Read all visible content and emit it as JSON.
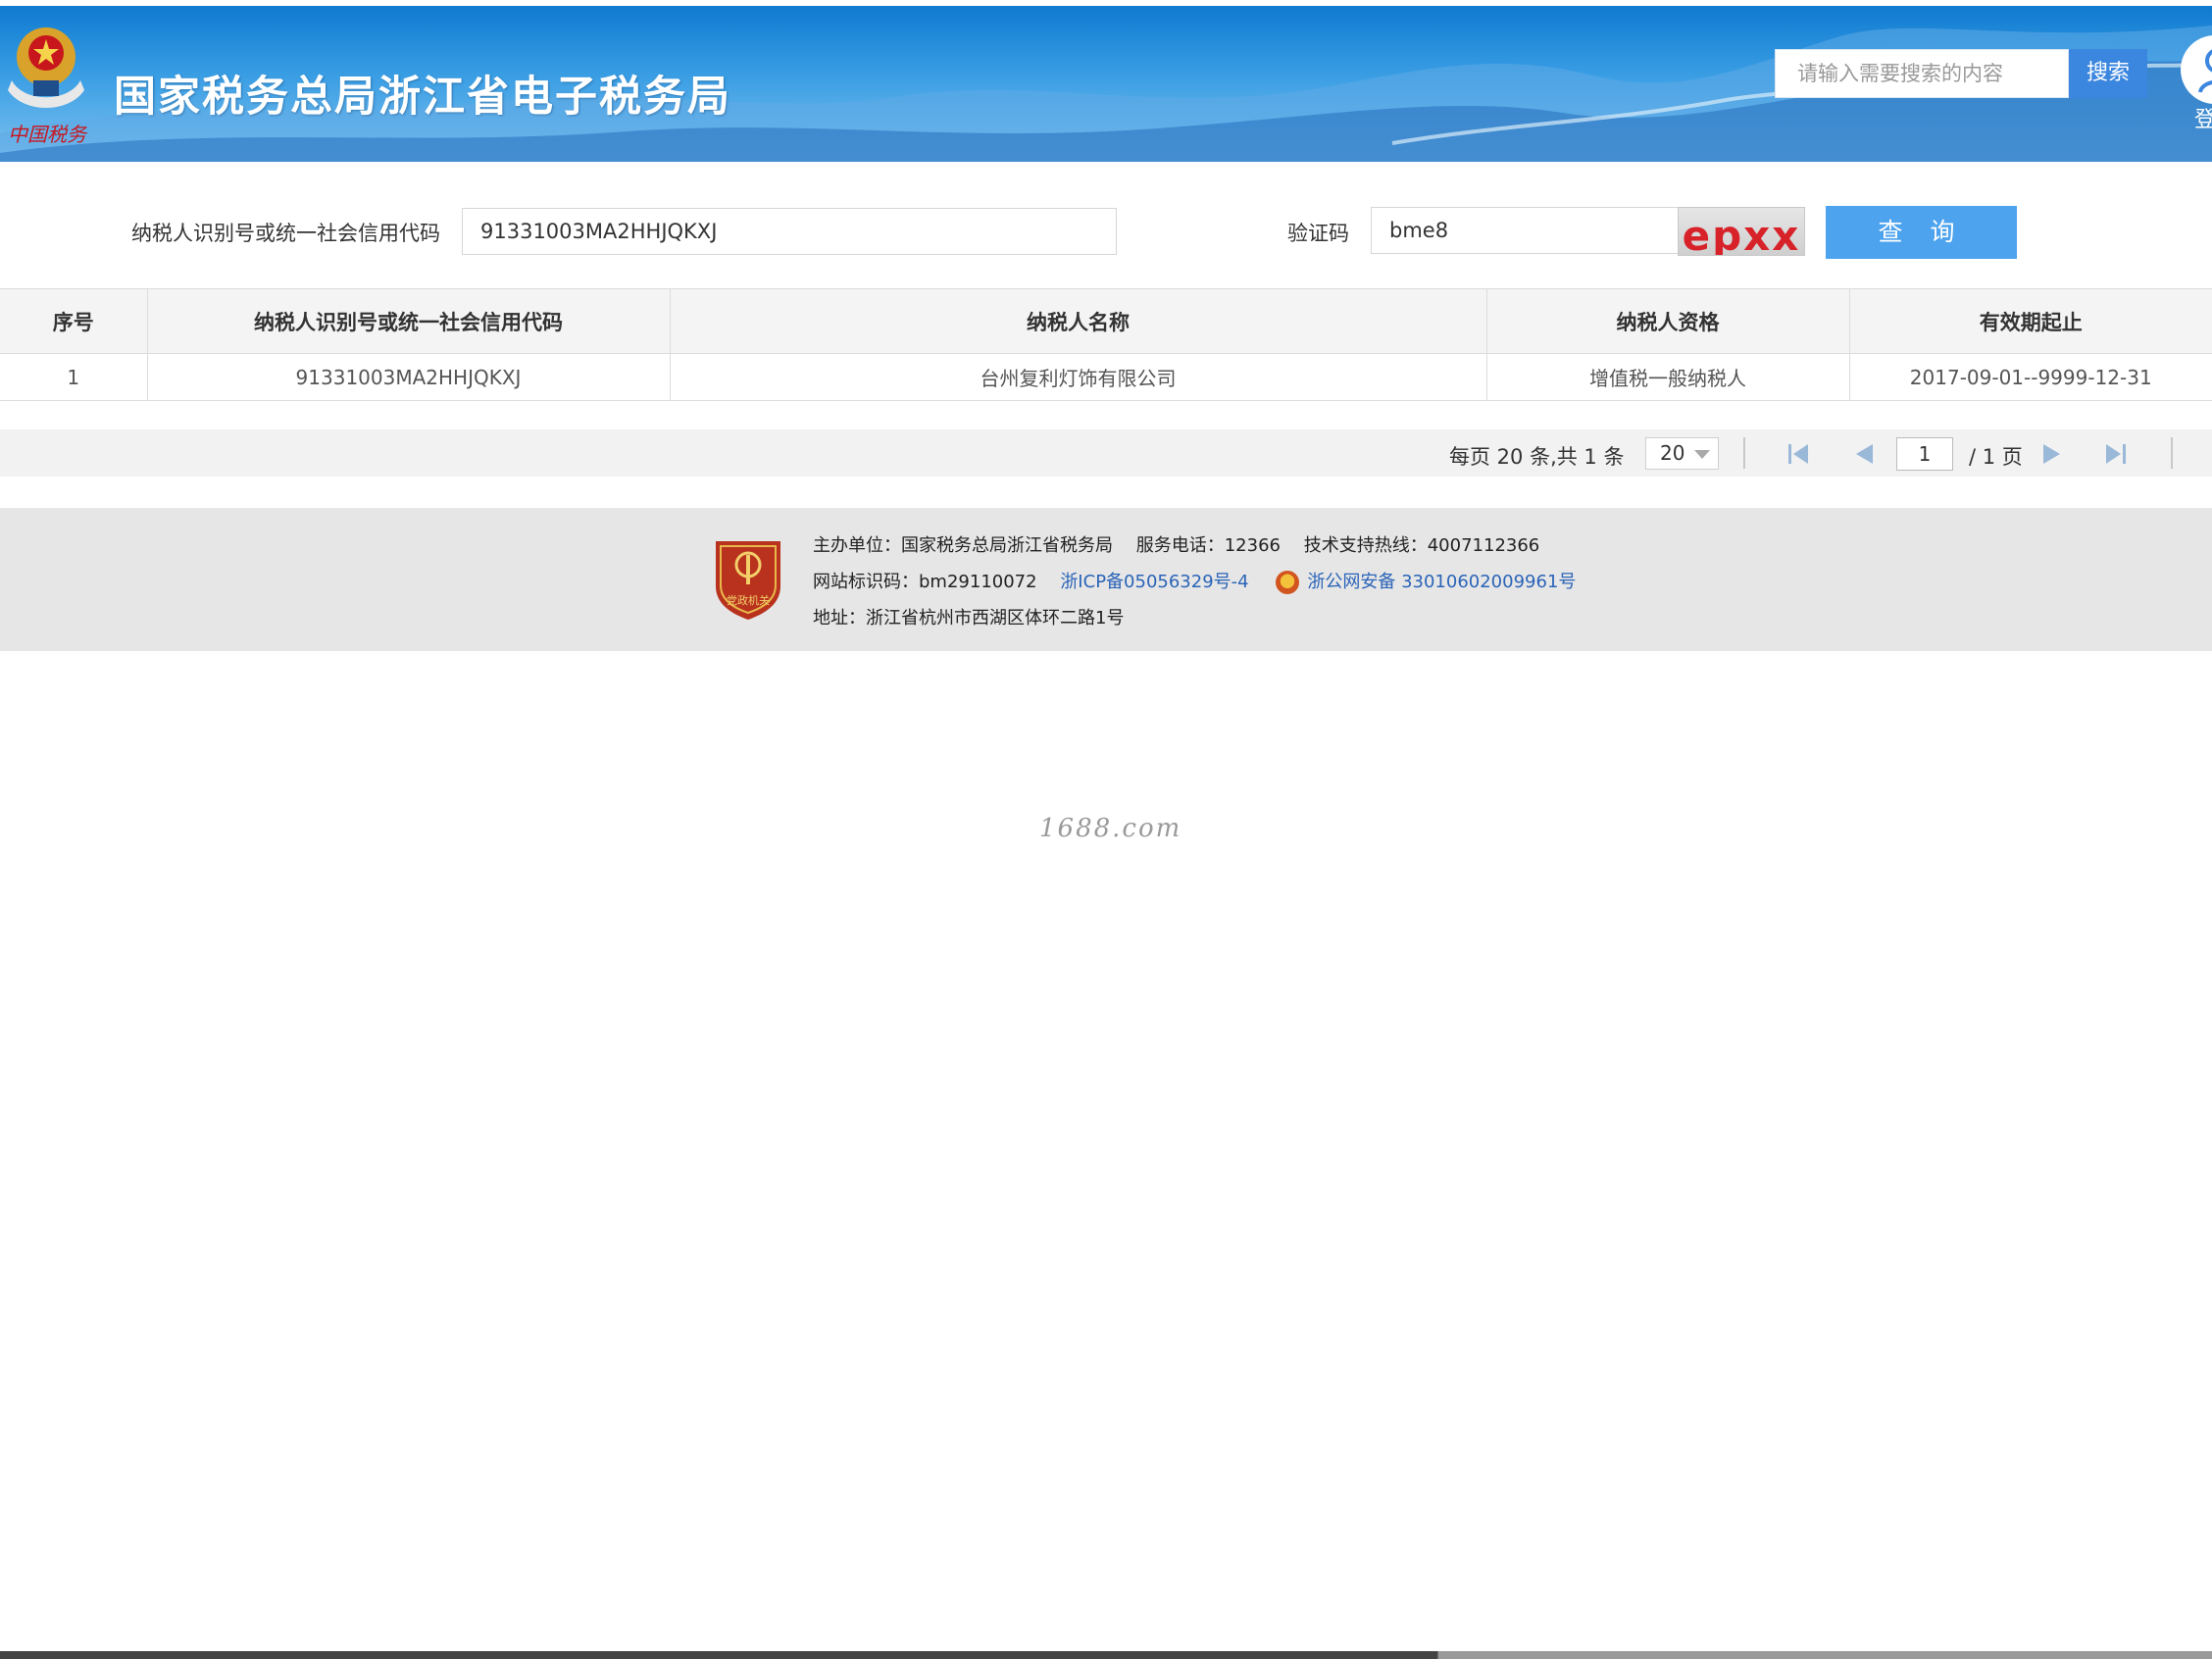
{
  "header": {
    "site_title": "国家税务总局浙江省电子税务局",
    "emblem_caption": "中国税务",
    "search_placeholder": "请输入需要搜索的内容",
    "search_button": "搜索",
    "login_label": "登"
  },
  "query_form": {
    "taxpayer_id_label": "纳税人识别号或统一社会信用代码",
    "taxpayer_id_value": "91331003MA2HHJQKXJ",
    "captcha_label": "验证码",
    "captcha_value": "bme8",
    "captcha_image_text": "epxx",
    "query_button": "查 询"
  },
  "results": {
    "columns": [
      "序号",
      "纳税人识别号或统一社会信用代码",
      "纳税人名称",
      "纳税人资格",
      "有效期起止"
    ],
    "rows": [
      [
        "1",
        "91331003MA2HHJQKXJ",
        "台州复利灯饰有限公司",
        "增值税一般纳税人",
        "2017-09-01--9999-12-31"
      ]
    ]
  },
  "pagination": {
    "info": "每页 20 条,共 1 条",
    "page_size": "20",
    "current_page": "1",
    "total_pages": "/ 1 页"
  },
  "footer": {
    "badge_text": "党政机关",
    "sponsor": "主办单位：国家税务总局浙江省税务局",
    "service_phone": "服务电话：12366",
    "tech_hotline": "技术支持热线：4007112366",
    "site_id": "网站标识码：bm29110072",
    "icp": "浙ICP备05056329号-4",
    "police_record": "浙公网安备 33010602009961号",
    "address": "地址：浙江省杭州市西湖区体环二路1号"
  },
  "watermark": "1688.com",
  "colors": {
    "header_blue": "#1a86d8",
    "query_button": "#4da3ee",
    "search_button": "#3b86df",
    "link": "#2b64b8",
    "captcha_text": "#d8222a"
  },
  "icons": [
    "national-tax-emblem",
    "user-login-icon",
    "first-page-icon",
    "prev-page-icon",
    "next-page-icon",
    "last-page-icon",
    "party-government-badge",
    "public-security-icon"
  ]
}
